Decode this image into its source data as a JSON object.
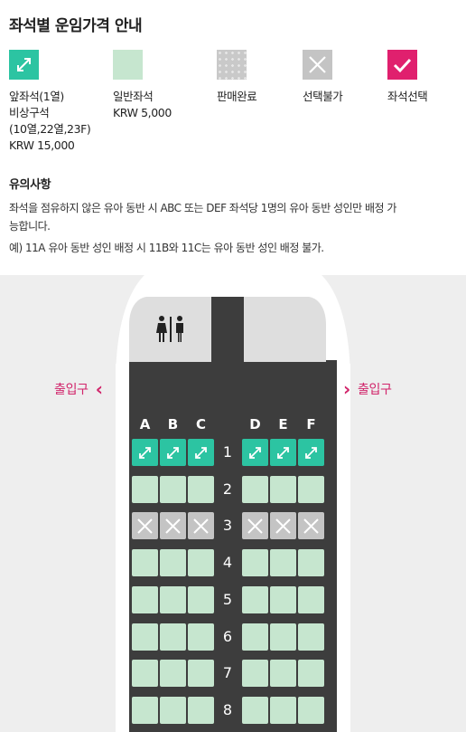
{
  "title": "좌석별 운임가격 안내",
  "legend": [
    {
      "type": "front",
      "icon": "expand-arrow-icon",
      "lines": [
        "앞좌석(1열)",
        "비상구석",
        "(10열,22열,23F)",
        "KRW 15,000"
      ]
    },
    {
      "type": "normal",
      "icon": "",
      "lines": [
        "일반좌석",
        "KRW 5,000"
      ]
    },
    {
      "type": "sold",
      "icon": "dotted-pattern",
      "lines": [
        "판매완료"
      ]
    },
    {
      "type": "blocked",
      "icon": "x-icon",
      "lines": [
        "선택불가"
      ]
    },
    {
      "type": "selected",
      "icon": "check-icon",
      "lines": [
        "좌석선택"
      ]
    }
  ],
  "notice": {
    "title": "유의사항",
    "line1": "좌석을 점유하지 않은 유아 동반 시 ABC 또는 DEF 좌석당 1명의 유아 동반 성인만 배정 가",
    "line2": "능합니다.",
    "line3": "예) 11A 유아 동반 성인 배정 시 11B와 11C는 유아 동반 성인 배정 불가."
  },
  "seatmap": {
    "exit_left": "출입구",
    "exit_right": "출입구",
    "columns_left": [
      "A",
      "B",
      "C"
    ],
    "columns_right": [
      "D",
      "E",
      "F"
    ],
    "rows": [
      {
        "num": "1",
        "status": "front"
      },
      {
        "num": "2",
        "status": "normal"
      },
      {
        "num": "3",
        "status": "blocked"
      },
      {
        "num": "4",
        "status": "normal"
      },
      {
        "num": "5",
        "status": "normal"
      },
      {
        "num": "6",
        "status": "normal"
      },
      {
        "num": "7",
        "status": "normal"
      },
      {
        "num": "8",
        "status": "normal"
      }
    ],
    "icons": {
      "toilet": "restroom-icon",
      "exit_left": "chevron-left-icon",
      "exit_right": "chevron-right-icon"
    }
  },
  "colors": {
    "front": "#2cc4a2",
    "normal": "#c6e6cf",
    "blocked": "#c4c4c4",
    "selected": "#e0206e",
    "cabin": "#3d3d3d",
    "exit_text": "#d1246a"
  }
}
